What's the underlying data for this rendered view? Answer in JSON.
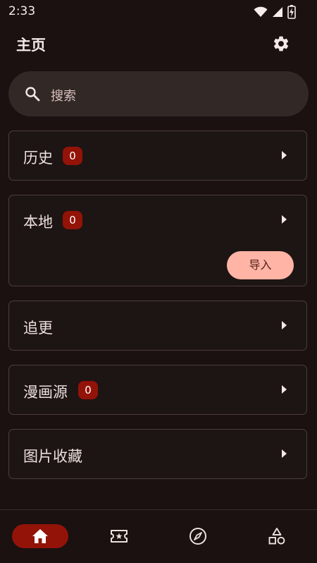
{
  "status_bar": {
    "time": "2:33",
    "icons": [
      "wifi-icon",
      "signal-icon",
      "battery-charging-icon"
    ]
  },
  "app_bar": {
    "title": "主页",
    "settings_icon": "gear-icon"
  },
  "search": {
    "placeholder": "搜索",
    "icon": "search-icon"
  },
  "cards": {
    "history": {
      "label": "历史",
      "count": "0"
    },
    "local": {
      "label": "本地",
      "count": "0",
      "import_label": "导入"
    },
    "following": {
      "label": "追更"
    },
    "comic_source": {
      "label": "漫画源",
      "count": "0"
    },
    "image_favorites": {
      "label": "图片收藏"
    }
  },
  "bottom_nav": {
    "items": [
      {
        "icon": "home-icon",
        "active": true
      },
      {
        "icon": "ticket-star-icon",
        "active": false
      },
      {
        "icon": "compass-icon",
        "active": false
      },
      {
        "icon": "categories-shapes-icon",
        "active": false
      }
    ]
  },
  "colors": {
    "background": "#1a1110",
    "accent": "#931308",
    "import_button": "#ffb4a6",
    "search_bar": "#322826",
    "card_border": "#4a3e3c"
  }
}
